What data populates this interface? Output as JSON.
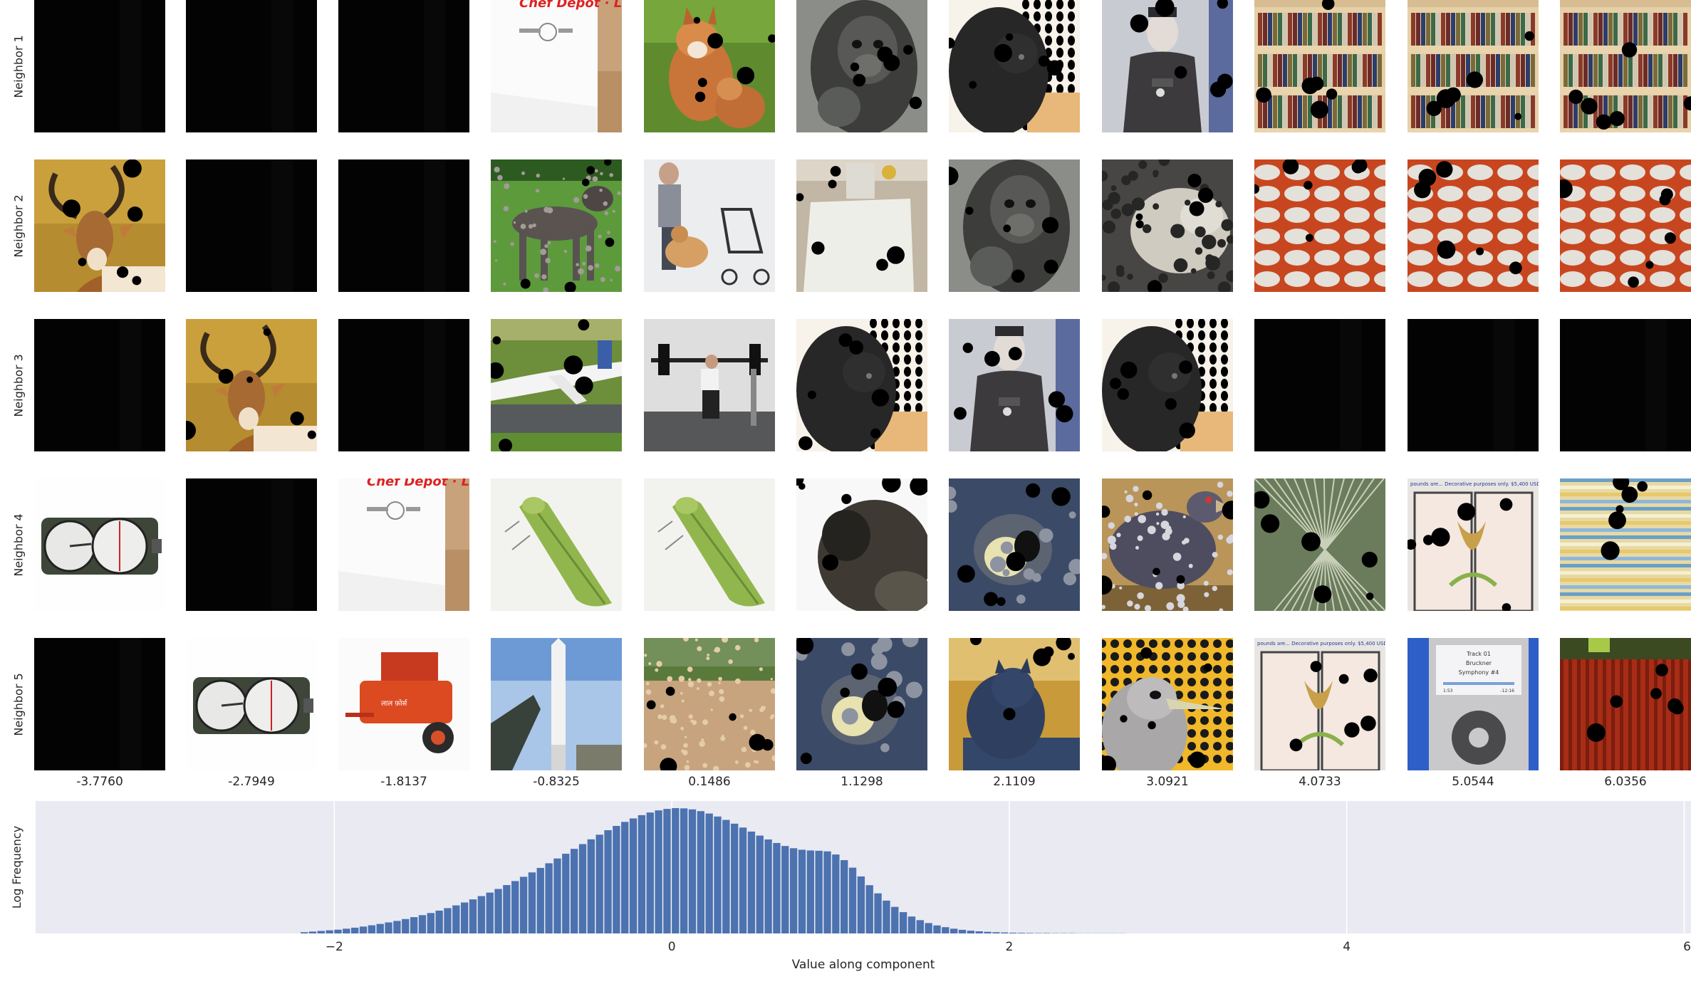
{
  "row_labels": [
    "Neighbor 1",
    "Neighbor 2",
    "Neighbor 3",
    "Neighbor 4",
    "Neighbor 5"
  ],
  "column_values": [
    "-3.7760",
    "-2.7949",
    "-1.8137",
    "-0.8325",
    "0.1486",
    "1.1298",
    "2.1109",
    "3.0921",
    "4.0733",
    "5.0544",
    "6.0356"
  ],
  "image_texts": {
    "chef_depot_banner": "Chef Depot · Lo",
    "watermark": "pounds are... Decorative purposes only. $5,400 USD",
    "player_track": "Track 01",
    "player_artist": "Bruckner",
    "player_title": "Symphony #4",
    "player_time_left": "1:53",
    "player_time_right": "-12:16"
  },
  "tiles": [
    [
      "dark",
      "dark",
      "dark",
      "cardboard_box",
      "fox",
      "gorilla",
      "black_dog_dots",
      "soldier",
      "bookshelf",
      "bookshelf",
      "bookshelf"
    ],
    [
      "antelope",
      "dark",
      "dark",
      "pointer_dog",
      "man_dog_stroller",
      "toilet_paper",
      "gorilla",
      "snow_leopard",
      "knit_orange",
      "knit_orange",
      "knit_orange"
    ],
    [
      "dark",
      "antelope",
      "dark",
      "airplane",
      "weightlifter",
      "black_dog_dots",
      "soldier",
      "black_dog_dots",
      "keyboard",
      "keyboard",
      "keyboard"
    ],
    [
      "compass",
      "dark",
      "cardboard_box",
      "leafhopper",
      "leafhopper",
      "monkey",
      "cow_fabric",
      "chicken",
      "glass_shards",
      "stained_glass",
      "knit_blue"
    ],
    [
      "dark",
      "compass",
      "red_machine",
      "missile",
      "wheat_field",
      "cow_fabric",
      "cat_blue",
      "heron_dots",
      "stained_glass",
      "music_player",
      "red_curtain"
    ]
  ],
  "chart_data": {
    "type": "bar",
    "xlabel": "Value along component",
    "ylabel": "Log Frequency",
    "xlim": [
      -3.77,
      6.04
    ],
    "xticks": [
      -2,
      0,
      2,
      4,
      6
    ],
    "xtick_labels": [
      "−2",
      "0",
      "2",
      "4",
      "6"
    ],
    "y_scale": "log",
    "grid": true,
    "background": "#eaeaf2",
    "bar_color": "#4c72b0",
    "bin_width": 0.05,
    "bins_x": [
      -2.2,
      -2.15,
      -2.1,
      -2.05,
      -2.0,
      -1.95,
      -1.9,
      -1.85,
      -1.8,
      -1.75,
      -1.7,
      -1.65,
      -1.6,
      -1.55,
      -1.5,
      -1.45,
      -1.4,
      -1.35,
      -1.3,
      -1.25,
      -1.2,
      -1.15,
      -1.1,
      -1.05,
      -1.0,
      -0.95,
      -0.9,
      -0.85,
      -0.8,
      -0.75,
      -0.7,
      -0.65,
      -0.6,
      -0.55,
      -0.5,
      -0.45,
      -0.4,
      -0.35,
      -0.3,
      -0.25,
      -0.2,
      -0.15,
      -0.1,
      -0.05,
      0.0,
      0.05,
      0.1,
      0.15,
      0.2,
      0.25,
      0.3,
      0.35,
      0.4,
      0.45,
      0.5,
      0.55,
      0.6,
      0.65,
      0.7,
      0.75,
      0.8,
      0.85,
      0.9,
      0.95,
      1.0,
      1.05,
      1.1,
      1.15,
      1.2,
      1.25,
      1.3,
      1.35,
      1.4,
      1.45,
      1.5,
      1.55,
      1.6,
      1.65,
      1.7,
      1.75,
      1.8,
      1.85,
      1.9,
      1.95,
      2.0,
      2.05,
      2.1,
      2.15,
      2.2,
      2.25,
      2.3,
      2.35,
      2.4,
      2.45,
      2.5,
      2.55,
      2.6,
      2.65
    ],
    "bins_height_fraction": [
      0.01,
      0.015,
      0.02,
      0.025,
      0.03,
      0.038,
      0.046,
      0.055,
      0.065,
      0.076,
      0.088,
      0.1,
      0.115,
      0.13,
      0.146,
      0.163,
      0.182,
      0.202,
      0.224,
      0.247,
      0.272,
      0.298,
      0.326,
      0.355,
      0.386,
      0.418,
      0.452,
      0.487,
      0.523,
      0.56,
      0.598,
      0.636,
      0.675,
      0.713,
      0.751,
      0.788,
      0.824,
      0.858,
      0.89,
      0.918,
      0.944,
      0.965,
      0.982,
      0.994,
      1.0,
      0.998,
      0.99,
      0.976,
      0.957,
      0.933,
      0.906,
      0.876,
      0.845,
      0.813,
      0.781,
      0.75,
      0.722,
      0.698,
      0.68,
      0.668,
      0.662,
      0.66,
      0.655,
      0.63,
      0.585,
      0.525,
      0.455,
      0.385,
      0.32,
      0.262,
      0.212,
      0.17,
      0.135,
      0.106,
      0.083,
      0.064,
      0.05,
      0.038,
      0.029,
      0.022,
      0.017,
      0.013,
      0.01,
      0.008,
      0.006,
      0.005,
      0.004,
      0.003,
      0.003,
      0.002,
      0.002,
      0.002,
      0.001,
      0.001,
      0.001,
      0.001,
      0.001,
      0.001
    ]
  }
}
